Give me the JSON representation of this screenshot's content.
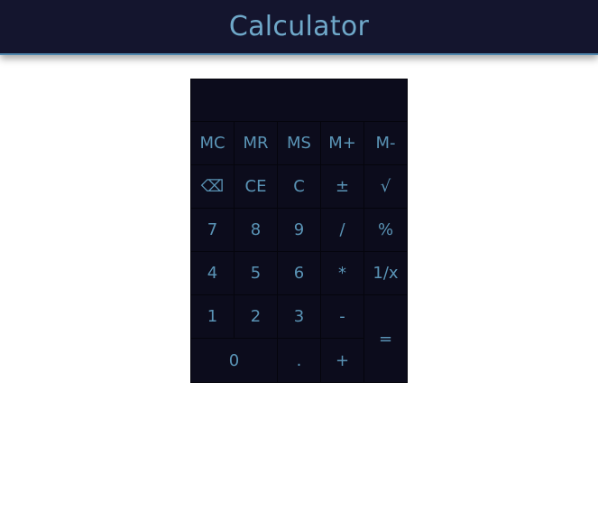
{
  "header": {
    "title": "Calculator"
  },
  "display": {
    "value": ""
  },
  "keys": {
    "mc": "MC",
    "mr": "MR",
    "ms": "MS",
    "mplus": "M+",
    "mminus": "M-",
    "backspace": "⌫",
    "ce": "CE",
    "c": "C",
    "plusminus": "±",
    "sqrt": "√",
    "k7": "7",
    "k8": "8",
    "k9": "9",
    "divide": "/",
    "percent": "%",
    "k4": "4",
    "k5": "5",
    "k6": "6",
    "multiply": "*",
    "reciprocal": "1/x",
    "k1": "1",
    "k2": "2",
    "k3": "3",
    "minus": "-",
    "equals": "=",
    "k0": "0",
    "decimal": ".",
    "plus": "+"
  },
  "colors": {
    "header_bg": "#14152e",
    "accent": "#6fa8c9",
    "key_bg": "#0c0c1c"
  }
}
